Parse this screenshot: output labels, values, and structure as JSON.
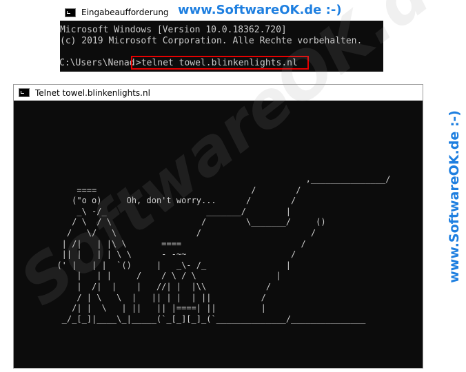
{
  "cmd_window": {
    "title": "Eingabeaufforderung",
    "lines": [
      "Microsoft Windows [Version 10.0.18362.720]",
      "(c) 2019 Microsoft Corporation. Alle Rechte vorbehalten."
    ],
    "prompt_path": "C:\\Users\\Nenad",
    "prompt_command": ">telnet towel.blinkenlights.nl",
    "highlight_color": "#e60000"
  },
  "telnet_window": {
    "title": "Telnet towel.blinkenlights.nl",
    "art_lines": [
      "                                                    ,_______________/",
      "      ====                               /        /",
      "     (\"o o)     Oh, don't worry...      /        /",
      "      _\\ -/_                    _______/        |",
      "     / \\  / \\                  /        \\_______/     ()",
      "    /   \\/   \\                /                      /",
      "   | /|   | |\\ \\       ====                        /",
      "   || |   | | \\ \\      - -~~                     /",
      "  (' |   | |  `()     |   _\\- /_                |",
      "      |   | |     /    / \\ / \\                |",
      "      |  /|  |    |   //| |  |\\\\            /",
      "      / | \\   \\  |   || | |  | ||          /",
      "     /| |  \\   | ||   || |====| ||         |",
      "   _/_[_]|____\\_|_____(`_[_][_]_(`______________/_______________"
    ]
  },
  "branding": {
    "top": "www.SoftwareOK.de :-)",
    "side": "www.SoftwareOK.de :-)",
    "watermark": "SoftwareOK.de",
    "color": "#1e7fe0"
  }
}
